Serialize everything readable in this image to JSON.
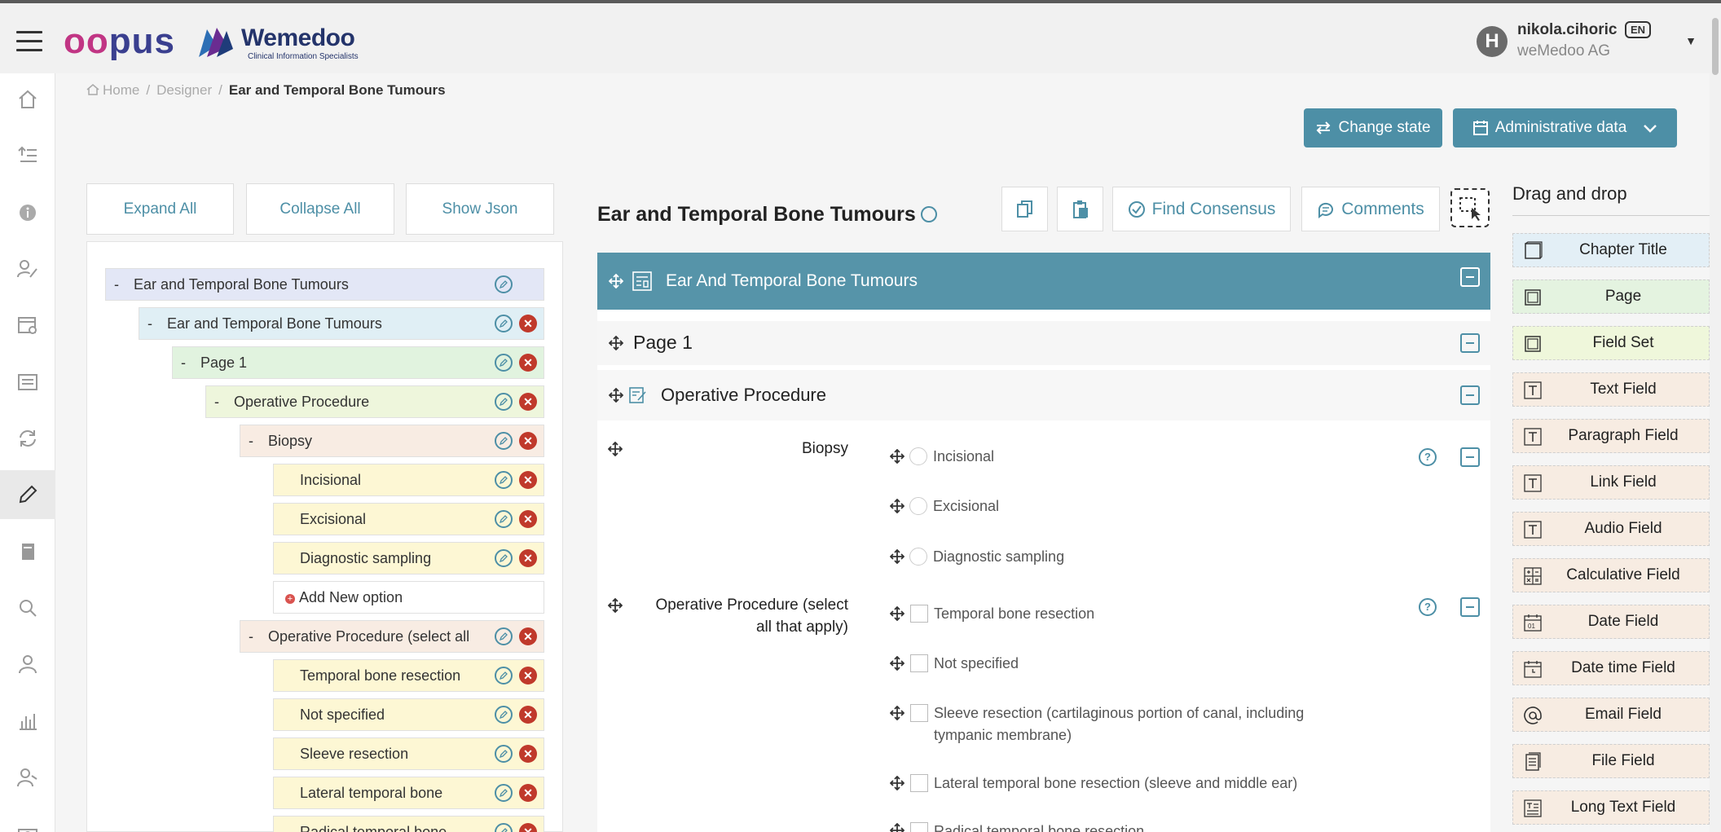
{
  "header": {
    "logo_opus": "opus",
    "logo_wemedoo": "Wemedoo",
    "logo_wemedoo_sub": "Clinical Information Specialists",
    "user_initial": "H",
    "user_name": "nikola.cihoric",
    "language": "EN",
    "organization": "weMedoo AG"
  },
  "rail": {
    "icons": [
      "home-icon",
      "indent-icon",
      "info-icon",
      "user-edit-icon",
      "settings-panel-icon",
      "list-panel-icon",
      "sync-icon",
      "pencil-icon",
      "book-icon",
      "search-icon",
      "person-icon",
      "bar-chart-icon",
      "users-icon",
      "camera-icon"
    ],
    "active_index": 7
  },
  "breadcrumb": {
    "home": "Home",
    "designer": "Designer",
    "current": "Ear and Temporal Bone Tumours"
  },
  "actions": {
    "change_state": "Change state",
    "administrative_data": "Administrative data"
  },
  "tree": {
    "expand_all": "Expand All",
    "collapse_all": "Collapse All",
    "show_json": "Show Json",
    "items": [
      {
        "label": "Ear and Temporal Bone Tumours",
        "collapse": "-"
      },
      {
        "label": "Ear and Temporal Bone Tumours",
        "collapse": "-"
      },
      {
        "label": "Page 1",
        "collapse": "-"
      },
      {
        "label": "Operative Procedure",
        "collapse": "-"
      },
      {
        "label": "Biopsy",
        "collapse": "-"
      },
      {
        "label": "Incisional"
      },
      {
        "label": "Excisional"
      },
      {
        "label": "Diagnostic sampling"
      },
      {
        "label": "Add New option"
      },
      {
        "label": "Operative Procedure (select all",
        "collapse": "-"
      },
      {
        "label": "Temporal bone resection"
      },
      {
        "label": "Not specified"
      },
      {
        "label": "Sleeve resection"
      },
      {
        "label": "Lateral temporal bone"
      },
      {
        "label": "Radical temporal bone"
      }
    ]
  },
  "canvas": {
    "title": "Ear and Temporal Bone Tumours",
    "toolbar": {
      "find_consensus": "Find Consensus",
      "comments": "Comments"
    },
    "chapter_title": "Ear And Temporal Bone Tumours",
    "page_title": "Page 1",
    "fieldset_title": "Operative Procedure",
    "fields": [
      {
        "label": "Biopsy",
        "options": [
          "Incisional",
          "Excisional",
          "Diagnostic sampling"
        ]
      },
      {
        "label_line1": "Operative Procedure (select",
        "label_line2": "all that apply)",
        "options": [
          "Temporal bone resection",
          "Not specified",
          "Sleeve resection (cartilaginous portion of canal, including",
          "tympanic membrane)",
          "Lateral temporal bone resection (sleeve and middle ear)",
          "Radical temporal bone resection"
        ]
      }
    ]
  },
  "palette": {
    "title": "Drag and drop",
    "items": [
      {
        "label": "Chapter Title",
        "icon": "chapter-icon"
      },
      {
        "label": "Page",
        "icon": "page-icon"
      },
      {
        "label": "Field Set",
        "icon": "fieldset-icon"
      },
      {
        "label": "Text Field",
        "icon": "text-t-icon"
      },
      {
        "label": "Paragraph Field",
        "icon": "text-t-icon"
      },
      {
        "label": "Link Field",
        "icon": "text-t-icon"
      },
      {
        "label": "Audio Field",
        "icon": "text-t-icon"
      },
      {
        "label": "Calculative Field",
        "icon": "calculator-icon"
      },
      {
        "label": "Date Field",
        "icon": "calendar-icon"
      },
      {
        "label": "Date time Field",
        "icon": "calendar-clock-icon"
      },
      {
        "label": "Email Field",
        "icon": "at-icon"
      },
      {
        "label": "File Field",
        "icon": "file-icon"
      },
      {
        "label": "Long Text Field",
        "icon": "long-text-icon"
      }
    ]
  },
  "colors": {
    "accent": "#4d8fa6",
    "chapter_bar": "#5694a9",
    "delete": "#c0392b"
  }
}
